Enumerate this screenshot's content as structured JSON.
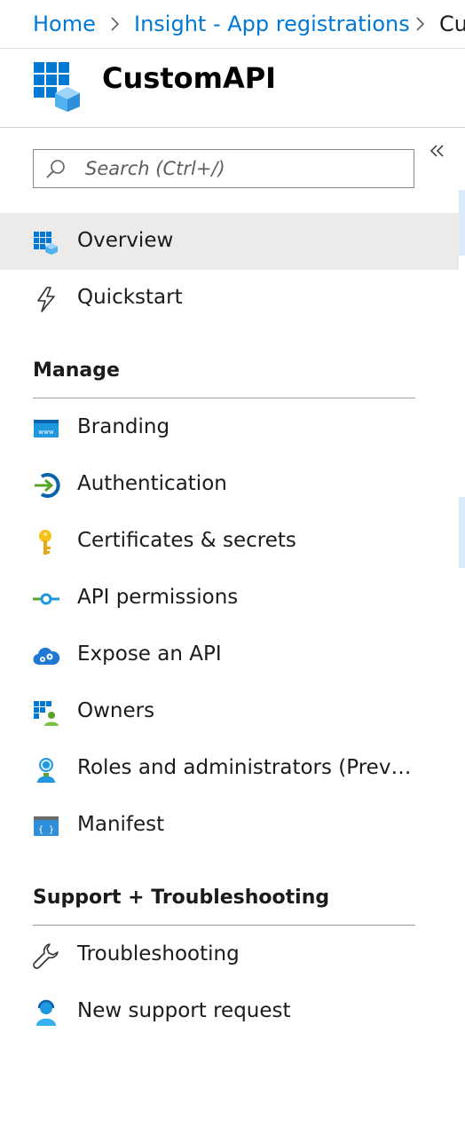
{
  "breadcrumb": {
    "items": [
      {
        "label": "Home"
      },
      {
        "label": "Insight - App registrations"
      },
      {
        "label": "Cu"
      }
    ]
  },
  "header": {
    "title": "CustomAPI",
    "icon": "app-registration-icon"
  },
  "sidebar": {
    "collapse_icon": "double-chevron-left-icon",
    "search": {
      "placeholder": "Search (Ctrl+/)",
      "value": "",
      "icon": "search-icon"
    },
    "top_items": [
      {
        "label": "Overview",
        "icon": "overview-grid-icon",
        "selected": true
      },
      {
        "label": "Quickstart",
        "icon": "lightning-icon",
        "selected": false
      }
    ],
    "sections": [
      {
        "heading": "Manage",
        "items": [
          {
            "label": "Branding",
            "icon": "www-window-icon"
          },
          {
            "label": "Authentication",
            "icon": "sign-in-arrow-icon"
          },
          {
            "label": "Certificates & secrets",
            "icon": "key-icon"
          },
          {
            "label": "API permissions",
            "icon": "api-connector-icon"
          },
          {
            "label": "Expose an API",
            "icon": "cloud-gears-icon"
          },
          {
            "label": "Owners",
            "icon": "owners-grid-user-icon"
          },
          {
            "label": "Roles and administrators (Previ...",
            "icon": "admin-user-icon"
          },
          {
            "label": "Manifest",
            "icon": "manifest-braces-icon"
          }
        ]
      },
      {
        "heading": "Support + Troubleshooting",
        "items": [
          {
            "label": "Troubleshooting",
            "icon": "wrench-icon"
          },
          {
            "label": "New support request",
            "icon": "support-user-icon"
          }
        ]
      }
    ]
  },
  "colors": {
    "link": "#0078d4",
    "selected_bg": "#edebe9",
    "strip": "#dbe9f8",
    "text": "#1b1b1b"
  }
}
